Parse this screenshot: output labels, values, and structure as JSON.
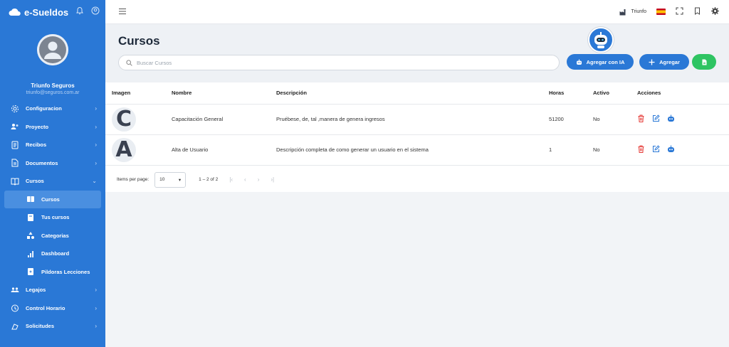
{
  "brand": {
    "name": "e-Sueldos"
  },
  "profile": {
    "name": "Triunfo Seguros",
    "email": "triunfo@seguros.com.ar"
  },
  "nav": [
    {
      "label": "Configuracion",
      "icon": "gear-icon",
      "chevron": "›"
    },
    {
      "label": "Proyecto",
      "icon": "people-icon",
      "chevron": "›"
    },
    {
      "label": "Recibos",
      "icon": "receipt-icon",
      "chevron": "›"
    },
    {
      "label": "Documentos",
      "icon": "document-icon",
      "chevron": "›"
    },
    {
      "label": "Cursos",
      "icon": "book-icon",
      "chevron": "⌄"
    },
    {
      "label": "Cursos",
      "icon": "course-icon",
      "sub": true,
      "active": true
    },
    {
      "label": "Tus cursos",
      "icon": "my-courses-icon",
      "sub": true
    },
    {
      "label": "Categorias",
      "icon": "categories-icon",
      "sub": true
    },
    {
      "label": "Dashboard",
      "icon": "bar-chart-icon",
      "sub": true
    },
    {
      "label": "Pildoras Lecciones",
      "icon": "pill-icon",
      "sub": true
    },
    {
      "label": "Legajos",
      "icon": "group-icon",
      "chevron": "›"
    },
    {
      "label": "Control Horario",
      "icon": "clock-icon",
      "chevron": "›"
    },
    {
      "label": "Solicitudes",
      "icon": "request-icon",
      "chevron": "›"
    }
  ],
  "topbar": {
    "tenant": "Triunfo"
  },
  "page": {
    "title": "Cursos",
    "search_placeholder": "Buscar Cursos",
    "ai_button": "Agregar con IA",
    "add_button": "Agregar"
  },
  "table": {
    "headers": {
      "image": "Imagen",
      "name": "Nombre",
      "description": "Descripción",
      "hours": "Horas",
      "active": "Activo",
      "actions": "Acciones"
    },
    "rows": [
      {
        "letter": "C",
        "name": "Capacitación General",
        "description": "Pruébese, de, tal ,manera de genera ingresos",
        "hours": "51200",
        "active": "No"
      },
      {
        "letter": "A",
        "name": "Alta de Usuario",
        "description": "Descripción completa de como generar un usuario en el sistema",
        "hours": "1",
        "active": "No"
      }
    ]
  },
  "paginator": {
    "items_label": "Items per page:",
    "page_size": "10",
    "range": "1 – 2 of 2"
  },
  "colors": {
    "primary": "#2a78d6",
    "success": "#2ec462",
    "danger": "#e53935"
  }
}
